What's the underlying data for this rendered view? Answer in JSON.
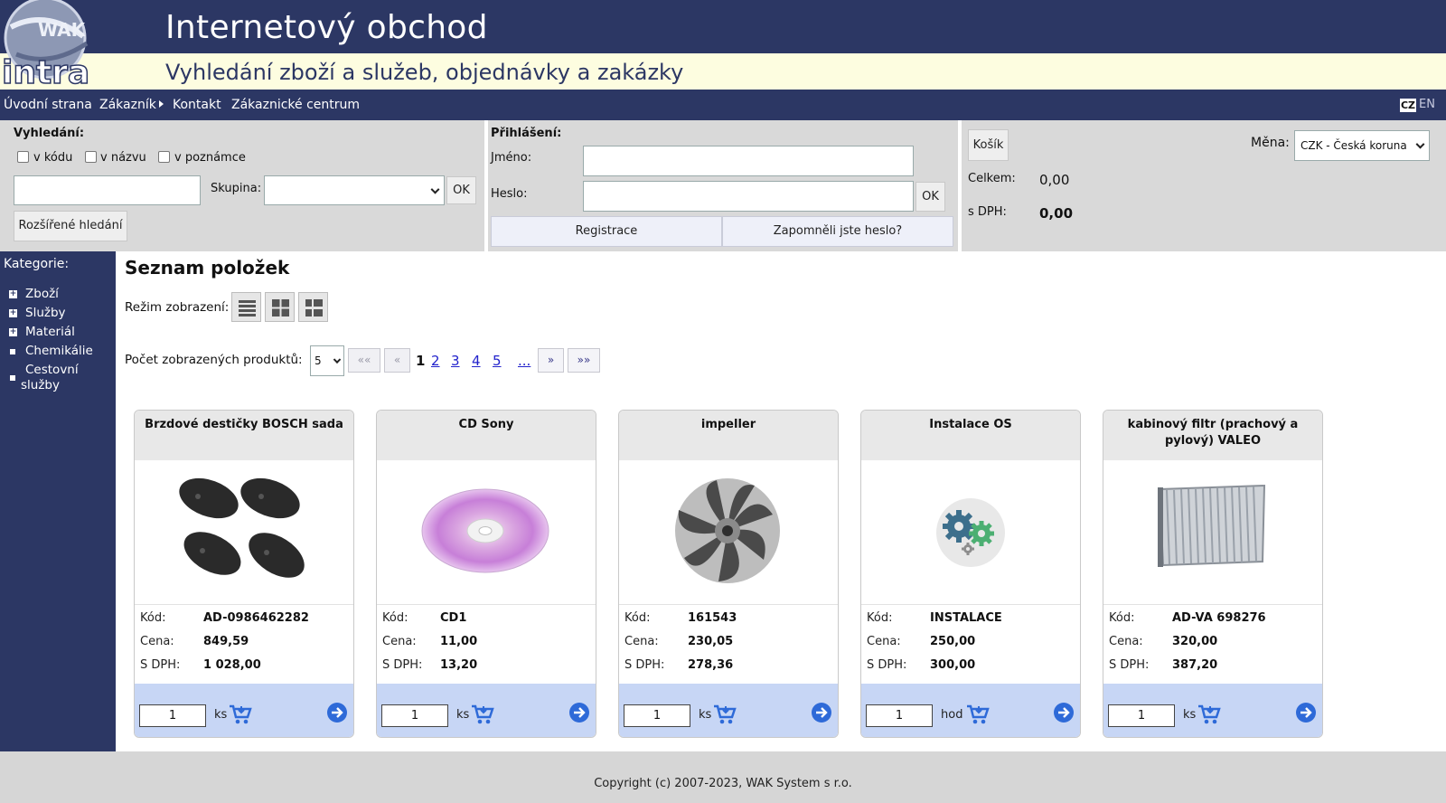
{
  "header": {
    "title": "Internetový obchod",
    "subtitle": "Vyhledání zboží a služeb, objednávky a zakázky",
    "logo_text": "intra",
    "logo_mark": "WAK"
  },
  "nav": {
    "items": [
      "Úvodní strana",
      "Zákazník",
      "Kontakt",
      "Zákaznické centrum"
    ],
    "lang_cz": "CZ",
    "lang_en": "EN"
  },
  "search": {
    "title": "Vyhledání:",
    "cb_code": "v kódu",
    "cb_name": "v názvu",
    "cb_note": "v poznámce",
    "group_label": "Skupina:",
    "ok": "OK",
    "advanced": "Rozšířené hledání"
  },
  "login": {
    "title": "Přihlášení:",
    "name_label": "Jméno:",
    "password_label": "Heslo:",
    "ok": "OK",
    "register": "Registrace",
    "forgot": "Zapomněli jste heslo?"
  },
  "cart": {
    "button": "Košík",
    "currency_label": "Měna:",
    "currency_value": "CZK - Česká koruna",
    "total_label": "Celkem:",
    "total_value": "0,00",
    "vat_label": "s DPH:",
    "vat_value": "0,00"
  },
  "sidebar": {
    "title": "Kategorie:",
    "items": [
      "Zboží",
      "Služby",
      "Materiál",
      "Chemikálie",
      "Cestovní",
      "služby"
    ]
  },
  "main": {
    "title": "Seznam položek",
    "view_mode_label": "Režim zobrazení:",
    "count_label": "Počet zobrazených produktů:",
    "count_value": "5",
    "pager": {
      "first": "««",
      "prev": "«",
      "current": "1",
      "pages": [
        "2",
        "3",
        "4",
        "5",
        "..."
      ],
      "next": "»",
      "last": "»»"
    }
  },
  "labels": {
    "code": "Kód:",
    "price": "Cena:",
    "vat": "S DPH:"
  },
  "products": [
    {
      "name": "Brzdové destičky BOSCH sada",
      "code": "AD-0986462282",
      "price": "849,59",
      "vat_price": "1 028,00",
      "qty": "1",
      "unit": "ks"
    },
    {
      "name": "CD Sony",
      "code": "CD1",
      "price": "11,00",
      "vat_price": "13,20",
      "qty": "1",
      "unit": "ks"
    },
    {
      "name": "impeller",
      "code": "161543",
      "price": "230,05",
      "vat_price": "278,36",
      "qty": "1",
      "unit": "ks"
    },
    {
      "name": "Instalace OS",
      "code": "INSTALACE",
      "price": "250,00",
      "vat_price": "300,00",
      "qty": "1",
      "unit": "hod"
    },
    {
      "name": "kabinový filtr (prachový a pylový) VALEO",
      "code": "AD-VA 698276",
      "price": "320,00",
      "vat_price": "387,20",
      "qty": "1",
      "unit": "ks"
    }
  ],
  "footer": {
    "copyright": "Copyright (c) 2007-2023, WAK System s r.o."
  },
  "colors": {
    "navy": "#2c3764",
    "band": "#fdfde0",
    "panel": "#d9d9d9",
    "card_foot": "#c7d6f5",
    "cart_icon": "#2e6ad8"
  },
  "icons": [
    "logo-globe-icon",
    "grid-list-icon",
    "grid-tiles-icon",
    "grid-rows-icon",
    "cart-icon",
    "arrow-right-circle-icon",
    "chevron-down-icon",
    "expand-plus-icon"
  ]
}
